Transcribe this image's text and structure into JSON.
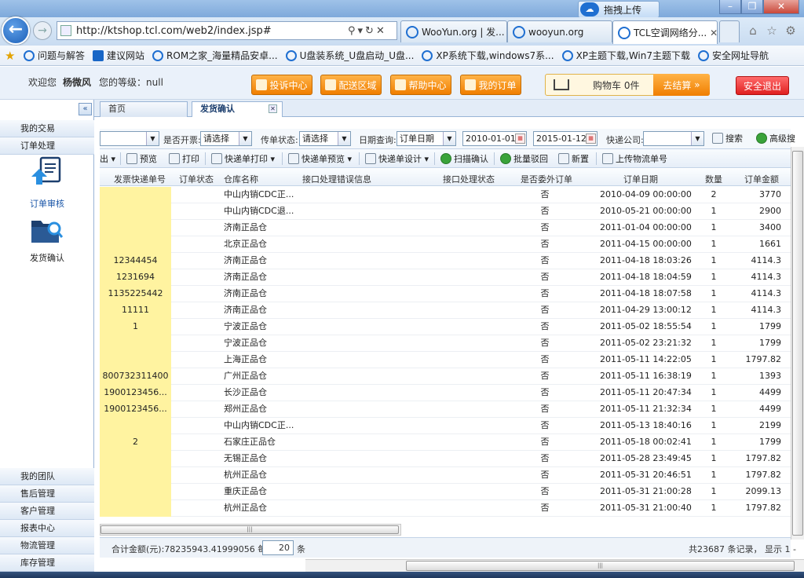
{
  "browser": {
    "upload_label": "拖拽上传",
    "url": "http://ktshop.tcl.com/web2/index.jsp#",
    "tabs": [
      {
        "label": "WooYun.org | 发..."
      },
      {
        "label": "wooyun.org"
      },
      {
        "label": "TCL空调网络分..."
      }
    ],
    "favorites": [
      {
        "label": "问题与解答"
      },
      {
        "label": "建议网站"
      },
      {
        "label": "ROM之家_海量精品安卓..."
      },
      {
        "label": "U盘装系统_U盘启动_U盘..."
      },
      {
        "label": "XP系统下载,windows7系..."
      },
      {
        "label": "XP主题下载,Win7主题下载"
      },
      {
        "label": "安全网址导航"
      }
    ]
  },
  "header": {
    "welcome": "欢迎您",
    "username": "杨微风",
    "level_label": "您的等级：null",
    "nav": [
      {
        "label": "投诉中心"
      },
      {
        "label": "配送区域"
      },
      {
        "label": "帮助中心"
      },
      {
        "label": "我的订单"
      }
    ],
    "cart_label": "购物车 0件",
    "checkout_label": "去结算",
    "logout_label": "安全退出"
  },
  "sidebar": {
    "collapse_label": "«",
    "top_items": [
      {
        "label": "我的交易"
      },
      {
        "label": "订单处理"
      }
    ],
    "big_items": [
      {
        "label": "订单审核"
      },
      {
        "label": "发货确认"
      }
    ],
    "bottom_items": [
      {
        "label": "我的团队"
      },
      {
        "label": "售后管理"
      },
      {
        "label": "客户管理"
      },
      {
        "label": "报表中心"
      },
      {
        "label": "物流管理"
      },
      {
        "label": "库存管理"
      }
    ]
  },
  "content_tabs": [
    {
      "label": "首页"
    },
    {
      "label": "发货确认"
    }
  ],
  "filters": {
    "invoice_label": "是否开票:",
    "invoice_value": "请选择",
    "transfer_label": "传单状态:",
    "transfer_value": "请选择",
    "date_label": "日期查询:",
    "date_type": "订单日期",
    "date_from": "2010-01-01",
    "date_to": "2015-01-12",
    "express_label": "快递公司:",
    "express_value": "",
    "search_label": "搜索",
    "advanced_label": "高级搜"
  },
  "toolbar": {
    "export": "出",
    "preview": "预览",
    "print": "打印",
    "express_print": "快递单打印",
    "express_preview": "快递单预览",
    "express_design": "快递单设计",
    "scan_confirm": "扫描确认",
    "batch_reject": "批量驳回",
    "dispatch": "新置",
    "upload_logistics": "上传物流单号"
  },
  "columns": {
    "track_no": "发票快递单号",
    "order_status": "订单状态",
    "warehouse": "仓库名称",
    "interface_error": "接口处理错误信息",
    "interface_status": "接口处理状态",
    "entrusted": "是否委外订单",
    "order_date": "订单日期",
    "qty": "数量",
    "amount": "订单金额"
  },
  "rows": [
    {
      "track": "",
      "wh": "中山内销CDC正...",
      "ent": "否",
      "date": "2010-04-09 00:00:00",
      "qty": "2",
      "amt": "3770"
    },
    {
      "track": "",
      "wh": "中山内销CDC退...",
      "ent": "否",
      "date": "2010-05-21 00:00:00",
      "qty": "1",
      "amt": "2900"
    },
    {
      "track": "",
      "wh": "济南正品仓",
      "ent": "否",
      "date": "2011-01-04 00:00:00",
      "qty": "1",
      "amt": "3400"
    },
    {
      "track": "",
      "wh": "北京正品仓",
      "ent": "否",
      "date": "2011-04-15 00:00:00",
      "qty": "1",
      "amt": "1661"
    },
    {
      "track": "12344454",
      "wh": "济南正品仓",
      "ent": "否",
      "date": "2011-04-18 18:03:26",
      "qty": "1",
      "amt": "4114.3"
    },
    {
      "track": "1231694",
      "wh": "济南正品仓",
      "ent": "否",
      "date": "2011-04-18 18:04:59",
      "qty": "1",
      "amt": "4114.3"
    },
    {
      "track": "1135225442",
      "wh": "济南正品仓",
      "ent": "否",
      "date": "2011-04-18 18:07:58",
      "qty": "1",
      "amt": "4114.3"
    },
    {
      "track": "11111",
      "wh": "济南正品仓",
      "ent": "否",
      "date": "2011-04-29 13:00:12",
      "qty": "1",
      "amt": "4114.3"
    },
    {
      "track": "1",
      "wh": "宁波正品仓",
      "ent": "否",
      "date": "2011-05-02 18:55:54",
      "qty": "1",
      "amt": "1799"
    },
    {
      "track": "",
      "wh": "宁波正品仓",
      "ent": "否",
      "date": "2011-05-02 23:21:32",
      "qty": "1",
      "amt": "1799"
    },
    {
      "track": "",
      "wh": "上海正品仓",
      "ent": "否",
      "date": "2011-05-11 14:22:05",
      "qty": "1",
      "amt": "1797.82"
    },
    {
      "track": "800732311400",
      "wh": "广州正品仓",
      "ent": "否",
      "date": "2011-05-11 16:38:19",
      "qty": "1",
      "amt": "1393"
    },
    {
      "track": "1900123456...",
      "wh": "长沙正品仓",
      "ent": "否",
      "date": "2011-05-11 20:47:34",
      "qty": "1",
      "amt": "4499"
    },
    {
      "track": "1900123456...",
      "wh": "郑州正品仓",
      "ent": "否",
      "date": "2011-05-11 21:32:34",
      "qty": "1",
      "amt": "4499"
    },
    {
      "track": "",
      "wh": "中山内销CDC正...",
      "ent": "否",
      "date": "2011-05-13 18:40:16",
      "qty": "1",
      "amt": "2199"
    },
    {
      "track": "2",
      "wh": "石家庄正品仓",
      "ent": "否",
      "date": "2011-05-18 00:02:41",
      "qty": "1",
      "amt": "1799"
    },
    {
      "track": "",
      "wh": "无锡正品仓",
      "ent": "否",
      "date": "2011-05-28 23:49:45",
      "qty": "1",
      "amt": "1797.82"
    },
    {
      "track": "",
      "wh": "杭州正品仓",
      "ent": "否",
      "date": "2011-05-31 20:46:51",
      "qty": "1",
      "amt": "1797.82"
    },
    {
      "track": "",
      "wh": "重庆正品仓",
      "ent": "否",
      "date": "2011-05-31 21:00:28",
      "qty": "1",
      "amt": "2099.13"
    },
    {
      "track": "",
      "wh": "杭州正品仓",
      "ent": "否",
      "date": "2011-05-31 21:00:40",
      "qty": "1",
      "amt": "1797.82"
    }
  ],
  "pager": {
    "total_prefix": "合计金额(元):78235943.41999056 每页",
    "page_size": "20",
    "page_unit": "条",
    "records": "共23687 条记录， 显示 1 -"
  },
  "icons": [
    "refresh-icon",
    "print-icon",
    "search-icon",
    "calendar-icon",
    "cart-icon",
    "folder-search-icon",
    "document-upload-icon"
  ],
  "colors": {
    "accent": "#f07e00",
    "logout": "#e02020",
    "highlight": "#fff3a0",
    "border": "#99b4d6"
  }
}
